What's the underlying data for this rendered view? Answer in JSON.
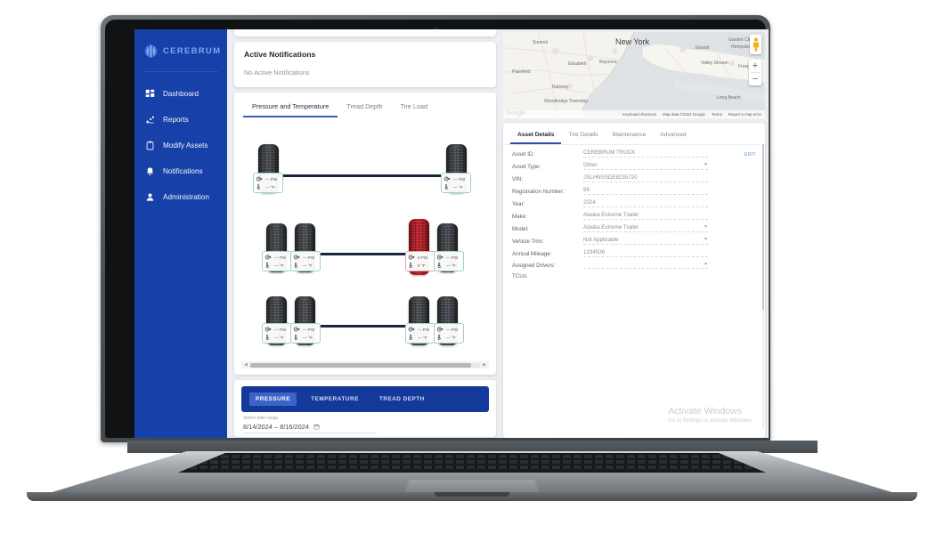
{
  "brand": {
    "name": "CEREBRUM",
    "logo_icon": "brain-icon",
    "color": "#7aa8f5"
  },
  "sidebar": {
    "bg": "#1740a8",
    "items": [
      {
        "label": "Dashboard",
        "icon": "grid-icon"
      },
      {
        "label": "Reports",
        "icon": "scatter-chart-icon"
      },
      {
        "label": "Modify Assets",
        "icon": "clipboard-icon"
      },
      {
        "label": "Notifications",
        "icon": "bell-icon"
      },
      {
        "label": "Administration",
        "icon": "person-icon"
      }
    ]
  },
  "notifications": {
    "title": "Active Notifications",
    "empty_text": "No Active Notifications"
  },
  "tire_panel": {
    "tabs": [
      {
        "label": "Pressure and Temperature",
        "active": true
      },
      {
        "label": "Tread Depth",
        "active": false
      },
      {
        "label": "Tire Load",
        "active": false
      }
    ],
    "pressure_unit": "PSI",
    "temp_unit": "°F",
    "empty_value": "—",
    "ok_color": "#9ed3bc",
    "alert_color": "#e7a1a4",
    "axles": [
      {
        "name": "steer-axle",
        "tires": [
          {
            "pos": "left-outer",
            "status": "ok",
            "pressure": "—",
            "temp": "—"
          },
          {
            "pos": "right-outer",
            "status": "ok",
            "pressure": "—",
            "temp": "—"
          }
        ]
      },
      {
        "name": "drive-axle-1",
        "tires": [
          {
            "pos": "left-outer",
            "status": "ok",
            "pressure": "—",
            "temp": "—"
          },
          {
            "pos": "left-inner",
            "status": "ok",
            "pressure": "—",
            "temp": "—"
          },
          {
            "pos": "right-inner",
            "status": "alert",
            "pressure": "0",
            "temp": "0"
          },
          {
            "pos": "right-outer",
            "status": "ok",
            "pressure": "—",
            "temp": "—"
          }
        ]
      },
      {
        "name": "drive-axle-2",
        "tires": [
          {
            "pos": "left-outer",
            "status": "ok",
            "pressure": "—",
            "temp": "—"
          },
          {
            "pos": "left-inner",
            "status": "ok",
            "pressure": "—",
            "temp": "—"
          },
          {
            "pos": "right-inner",
            "status": "ok",
            "pressure": "—",
            "temp": "—"
          },
          {
            "pos": "right-outer",
            "status": "ok",
            "pressure": "—",
            "temp": "—"
          }
        ]
      }
    ]
  },
  "chart_panel": {
    "metrics": [
      {
        "label": "PRESSURE",
        "active": true
      },
      {
        "label": "TEMPERATURE",
        "active": false
      },
      {
        "label": "TREAD DEPTH",
        "active": false
      }
    ],
    "date_label": "Select date range",
    "date_value": "8/14/2024 – 8/16/2024",
    "calendar_icon": "calendar-icon"
  },
  "map": {
    "title_label": "New York",
    "labels": [
      "Summit",
      "Elizabeth",
      "Bayonne",
      "Plainfield",
      "Rahway",
      "Woodbridge Township",
      "Elmont",
      "Garden City",
      "Hempstead",
      "Valley Stream",
      "Long Beach",
      "Freeport"
    ],
    "watermark": "Google",
    "footer": [
      "Keyboard shortcuts",
      "Map data ©2024 Google",
      "Terms",
      "Report a map error"
    ],
    "zoom_in": "+",
    "zoom_out": "−",
    "pegman_icon": "street-view-pegman-icon"
  },
  "details": {
    "tabs": [
      {
        "label": "Asset Details",
        "active": true
      },
      {
        "label": "Tire Details",
        "active": false
      },
      {
        "label": "Maintenance",
        "active": false
      },
      {
        "label": "Advanced",
        "active": false
      }
    ],
    "edit_label": "EDIT",
    "fields": [
      {
        "label": "Asset ID:",
        "value": "CEREBRUM TRUCK",
        "type": "text"
      },
      {
        "label": "Asset Type:",
        "value": "Other",
        "type": "select"
      },
      {
        "label": "VIN:",
        "value": "JSLHNSSDE8235720",
        "type": "text"
      },
      {
        "label": "Registration Number:",
        "value": "99",
        "type": "text"
      },
      {
        "label": "Year:",
        "value": "2024",
        "type": "text"
      },
      {
        "label": "Make:",
        "value": "Alaska Extreme Trailer",
        "type": "text"
      },
      {
        "label": "Model:",
        "value": "Alaska Extreme Trailer",
        "type": "select"
      },
      {
        "label": "Vehicle Trim:",
        "value": "Not Applicable",
        "type": "select"
      },
      {
        "label": "Annual Mileage:",
        "value": "1234536",
        "type": "text"
      },
      {
        "label": "Assigned Drivers:",
        "value": "",
        "type": "select"
      },
      {
        "label": "TCUs:",
        "value": "",
        "type": "text"
      }
    ]
  },
  "windows_watermark": {
    "line1": "Activate Windows",
    "line2": "Go to Settings to activate Windows."
  }
}
